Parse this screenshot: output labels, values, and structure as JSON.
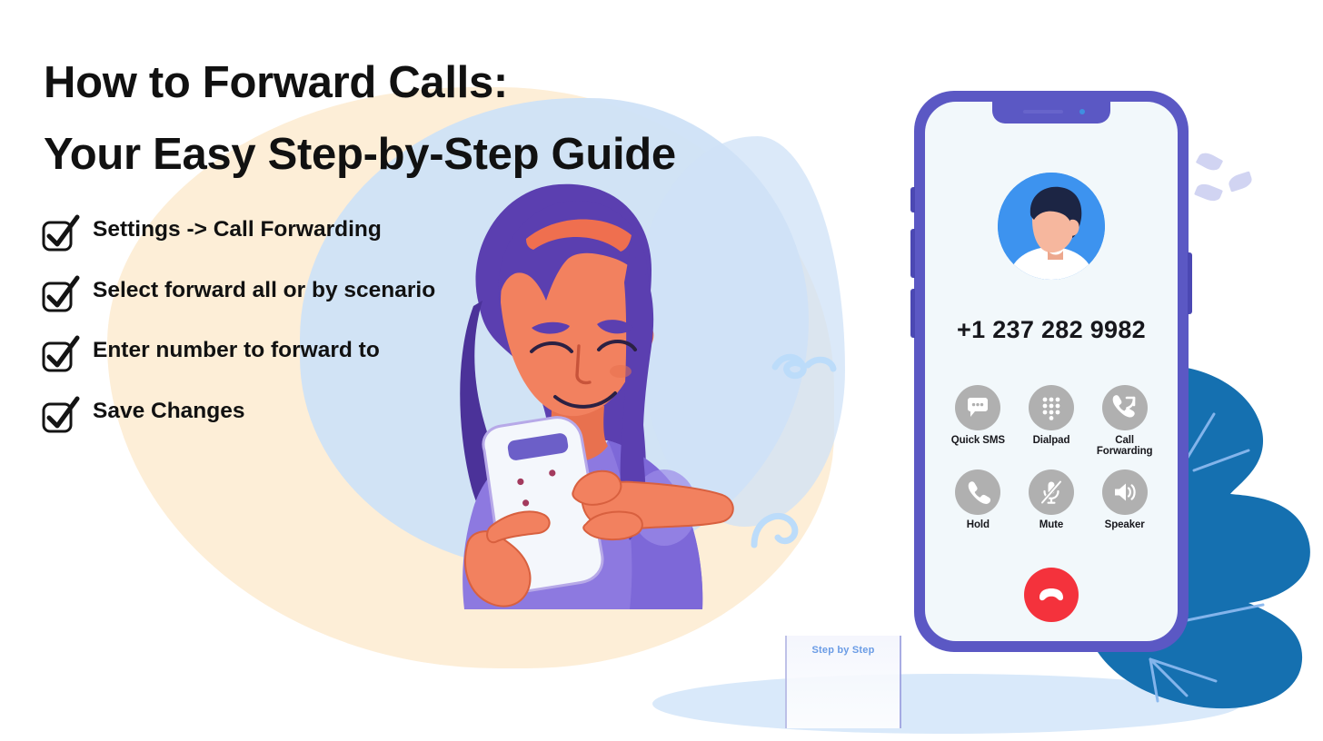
{
  "headline": {
    "line1": "How to Forward Calls:",
    "line2": "Your Easy Step-by-Step Guide"
  },
  "checklist": {
    "icon": "checkbox-check-icon",
    "items": [
      {
        "label": "Settings -> Call Forwarding"
      },
      {
        "label": "Select forward all or by scenario"
      },
      {
        "label": "Enter number to forward to"
      },
      {
        "label": "Save Changes"
      }
    ]
  },
  "decor": {
    "faint_card_text": "Step by Step",
    "colors": {
      "cream_blob": "#fdeed7",
      "light_blue_blob": "#cfe1f7",
      "ground_ellipse": "#d9e9fa",
      "blue_leaf": "#1570b0",
      "leaf_deco": "#c9cdf0"
    }
  },
  "phone": {
    "frame_color": "#5b58c4",
    "screen_color": "#f2f8fb",
    "avatar": {
      "name": "caller-avatar",
      "bg_color": "#3d93ef"
    },
    "caller_number": "+1 237 282 9982",
    "actions": [
      {
        "label": "Quick SMS",
        "icon": "quick-sms-icon",
        "name": "quick-sms"
      },
      {
        "label": "Dialpad",
        "icon": "dialpad-icon",
        "name": "dialpad"
      },
      {
        "label": "Call Forwarding",
        "icon": "call-forwarding-icon",
        "name": "call-forwarding"
      },
      {
        "label": "Hold",
        "icon": "hold-icon",
        "name": "hold"
      },
      {
        "label": "Mute",
        "icon": "mute-icon",
        "name": "mute"
      },
      {
        "label": "Speaker",
        "icon": "speaker-icon",
        "name": "speaker"
      }
    ],
    "end_call": {
      "icon": "end-call-icon",
      "color": "#f4323c"
    },
    "action_circle_color": "#b0b0b0"
  },
  "illustration": {
    "name": "woman-holding-phone-illustration",
    "hair_color": "#5b3fb0",
    "skin_color": "#f2815f",
    "shirt_color": "#8d79e0",
    "device_color": "#f4f7fc"
  }
}
